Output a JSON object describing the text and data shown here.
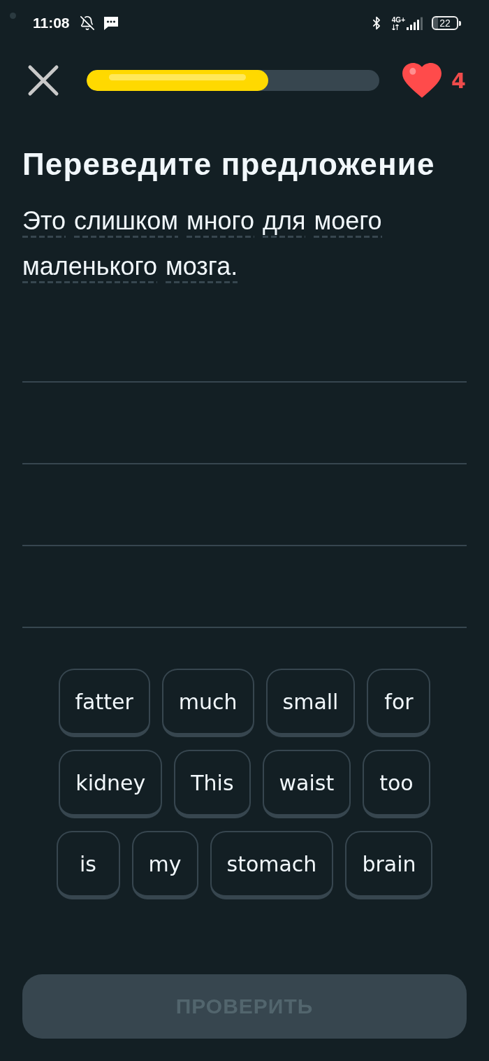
{
  "status_bar": {
    "time": "11:08",
    "network": "4G+",
    "battery": "22"
  },
  "header": {
    "progress": {
      "level": 0.62
    },
    "hearts": "4"
  },
  "title": "Переведите предложение",
  "prompt": {
    "words": [
      "Это",
      "слишком",
      "много",
      "для",
      "моего",
      "маленького",
      "мозга."
    ]
  },
  "word_bank": [
    "fatter",
    "much",
    "small",
    "for",
    "kidney",
    "This",
    "waist",
    "too",
    "is",
    "my",
    "stomach",
    "brain"
  ],
  "check_button": {
    "label": "ПРОВЕРИТЬ",
    "disabled": true
  }
}
